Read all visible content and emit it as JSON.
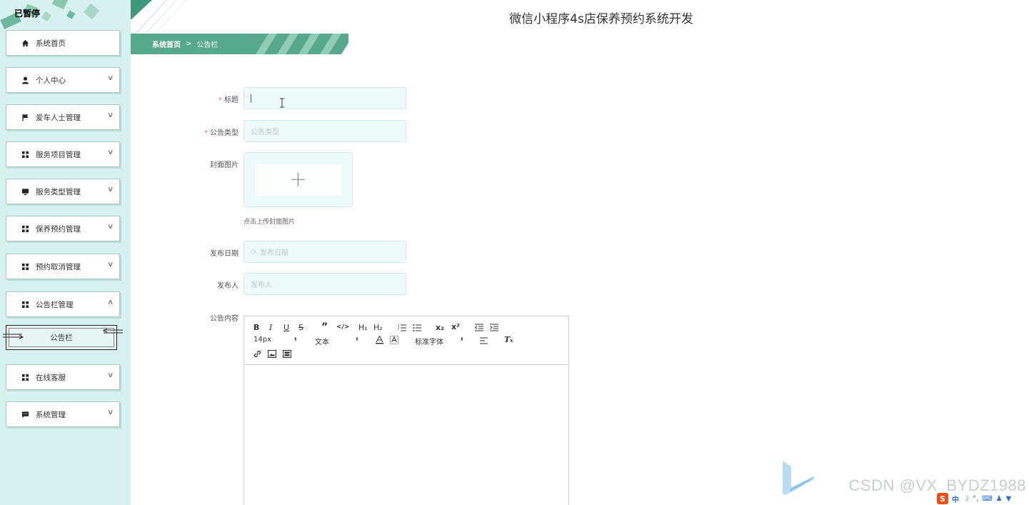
{
  "sidebar": {
    "tag": "已暂停",
    "items": [
      {
        "label": "系统首页",
        "icon": "home-icon",
        "expandable": false
      },
      {
        "label": "个人中心",
        "icon": "user-icon",
        "expandable": true
      },
      {
        "label": "爱车人士管理",
        "icon": "flag-icon",
        "expandable": true
      },
      {
        "label": "服务项目管理",
        "icon": "grid-icon",
        "expandable": true
      },
      {
        "label": "服务类型管理",
        "icon": "monitor-icon",
        "expandable": true
      },
      {
        "label": "保养预约管理",
        "icon": "grid-icon",
        "expandable": true
      },
      {
        "label": "预约取消管理",
        "icon": "grid-icon",
        "expandable": true
      },
      {
        "label": "公告栏管理",
        "icon": "grid-icon",
        "expandable": true,
        "expanded": true
      },
      {
        "label": "在线客服",
        "icon": "grid-icon",
        "expandable": true
      },
      {
        "label": "系统管理",
        "icon": "chat-icon",
        "expandable": true
      }
    ],
    "sub_item": "公告栏"
  },
  "header": {
    "title": "微信小程序4s店保养预约系统开发"
  },
  "breadcrumb": {
    "home": "系统首页",
    "separator": ">",
    "current": "公告栏"
  },
  "form": {
    "title_label": "标题",
    "type_label": "公告类型",
    "type_placeholder": "公告类型",
    "cover_label": "封面图片",
    "upload_hint": "点击上传封面图片",
    "date_label": "发布日期",
    "date_placeholder": "发布日期",
    "author_label": "发布人",
    "author_placeholder": "发布人",
    "content_label": "公告内容"
  },
  "editor": {
    "font_size": "14px",
    "text_style": "文本",
    "font_family": "标准字体",
    "buttons": [
      "B",
      "I",
      "U",
      "S",
      "”",
      "</>",
      "H1",
      "H2",
      "ordered-list",
      "bullet-list",
      "x₂",
      "x²",
      "outdent",
      "indent",
      "font-color",
      "background",
      "align",
      "clean",
      "link",
      "image",
      "video"
    ]
  },
  "watermark": {
    "text": "CSDN @VX_BYDZ1988"
  },
  "ime": {
    "lang": "中"
  },
  "colors": {
    "sidebar_bg": "#d6f1ee",
    "accent_green": "#57a98d",
    "required": "#f56c6c"
  }
}
